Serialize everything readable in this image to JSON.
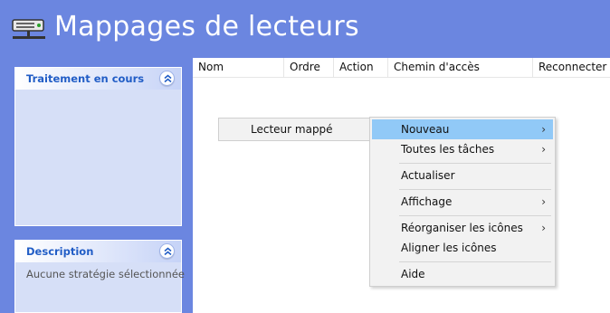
{
  "title": "Mappages de lecteurs",
  "title_icon": "network-drive-icon",
  "panes": {
    "processing": {
      "title": "Traitement en cours",
      "collapse_icon": "double-chevron-up-icon"
    },
    "description": {
      "title": "Description",
      "body": "Aucune stratégie sélectionnée",
      "collapse_icon": "double-chevron-up-icon"
    }
  },
  "columns": [
    "Nom",
    "Ordre",
    "Action",
    "Chemin d'accès",
    "Reconnecter"
  ],
  "submenu_parent": {
    "label": "Lecteur mappé"
  },
  "context_menu": {
    "items": [
      {
        "label": "Nouveau",
        "has_submenu": true,
        "highlighted": true
      },
      {
        "label": "Toutes les tâches",
        "has_submenu": true
      },
      {
        "label": "Actualiser",
        "has_submenu": false
      },
      {
        "label": "Affichage",
        "has_submenu": true
      },
      {
        "label": "Réorganiser les icônes",
        "has_submenu": true
      },
      {
        "label": "Aligner les icônes",
        "has_submenu": false
      },
      {
        "label": "Aide",
        "has_submenu": false
      }
    ],
    "arrow": "›"
  },
  "colors": {
    "background": "#6b86e0",
    "pane_fill": "#d6dff7",
    "pane_title": "#215dc6",
    "highlight": "#91c9f7"
  }
}
